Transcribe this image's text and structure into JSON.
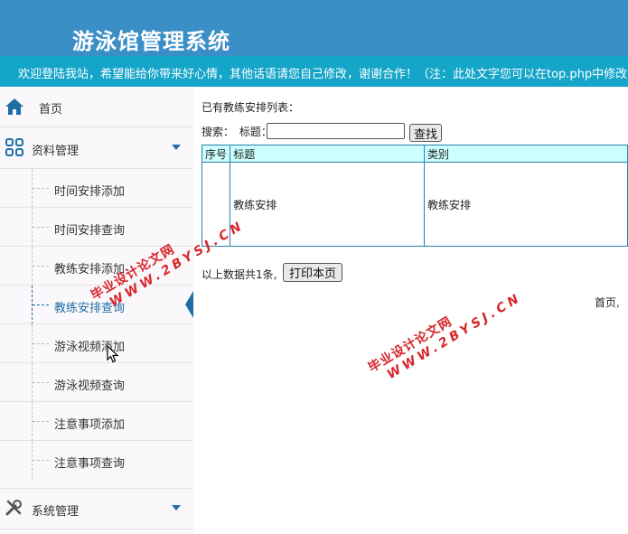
{
  "header": {
    "title": "游泳馆管理系统",
    "marquee": "欢迎登陆我站，希望能给你带来好心情，其他话语请您自己修改，谢谢合作！（注：此处文字您可以在top.php中修改）"
  },
  "sidebar": {
    "home_label": "首页",
    "groups": [
      {
        "label": "资料管理"
      },
      {
        "label": "系统管理"
      }
    ],
    "items": [
      {
        "label": "时间安排添加"
      },
      {
        "label": "时间安排查询"
      },
      {
        "label": "教练安排添加"
      },
      {
        "label": "教练安排查询"
      },
      {
        "label": "游泳视频添加"
      },
      {
        "label": "游泳视频查询"
      },
      {
        "label": "注意事项添加"
      },
      {
        "label": "注意事项查询"
      }
    ]
  },
  "content": {
    "list_title": "已有教练安排列表：",
    "search_label": "搜索：",
    "title_label": "标题：",
    "search_value": "",
    "search_button": "查找",
    "table": {
      "headers": [
        "序号",
        "标题",
        "类别"
      ],
      "rows": [
        {
          "index": "",
          "title": "教练安排",
          "category": "教练安排"
        }
      ]
    },
    "summary": "以上数据共1条,",
    "print_button": "打印本页",
    "pager": "首页,"
  },
  "watermark": {
    "line1": "毕业设计论文网",
    "line2": "WWW.2BYSJ.CN"
  },
  "colors": {
    "header_bg": "#3a8fc7",
    "marquee_bg": "#15a5c9",
    "accent": "#1d6fa5",
    "table_header_bg": "#ccffff",
    "watermark": "#d8262b"
  }
}
